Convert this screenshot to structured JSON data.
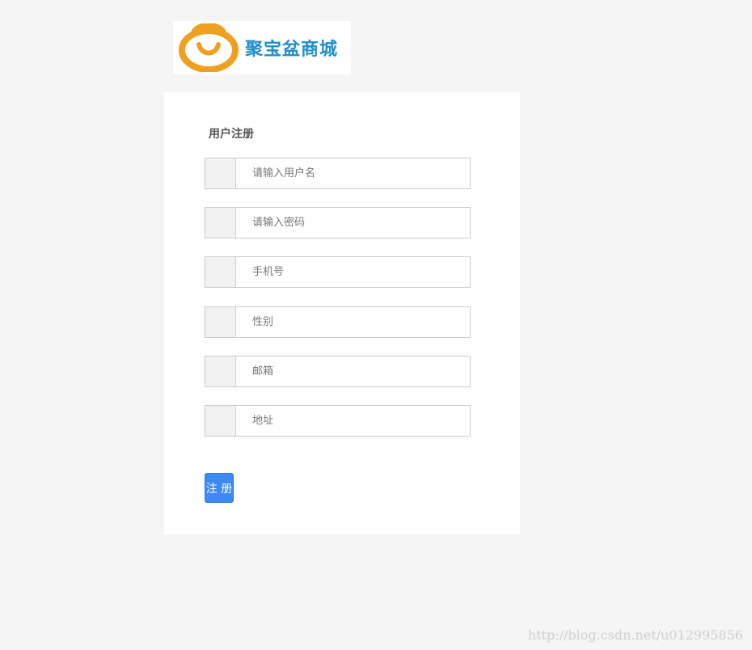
{
  "logo": {
    "text": "聚宝盆商城",
    "icon": "smile-pot-icon",
    "icon_color": "#f0a020",
    "text_color": "#1f8fcf"
  },
  "form": {
    "title": "用户注册",
    "fields": [
      {
        "name": "username",
        "placeholder": "请输入用户名",
        "value": ""
      },
      {
        "name": "password",
        "placeholder": "请输入密码",
        "value": ""
      },
      {
        "name": "phone",
        "placeholder": "手机号",
        "value": ""
      },
      {
        "name": "gender",
        "placeholder": "性别",
        "value": ""
      },
      {
        "name": "email",
        "placeholder": "邮箱",
        "value": ""
      },
      {
        "name": "address",
        "placeholder": "地址",
        "value": ""
      }
    ],
    "submit_label": "注 册",
    "submit_color": "#3d8af7"
  },
  "watermark": "http://blog.csdn.net/u012995856"
}
